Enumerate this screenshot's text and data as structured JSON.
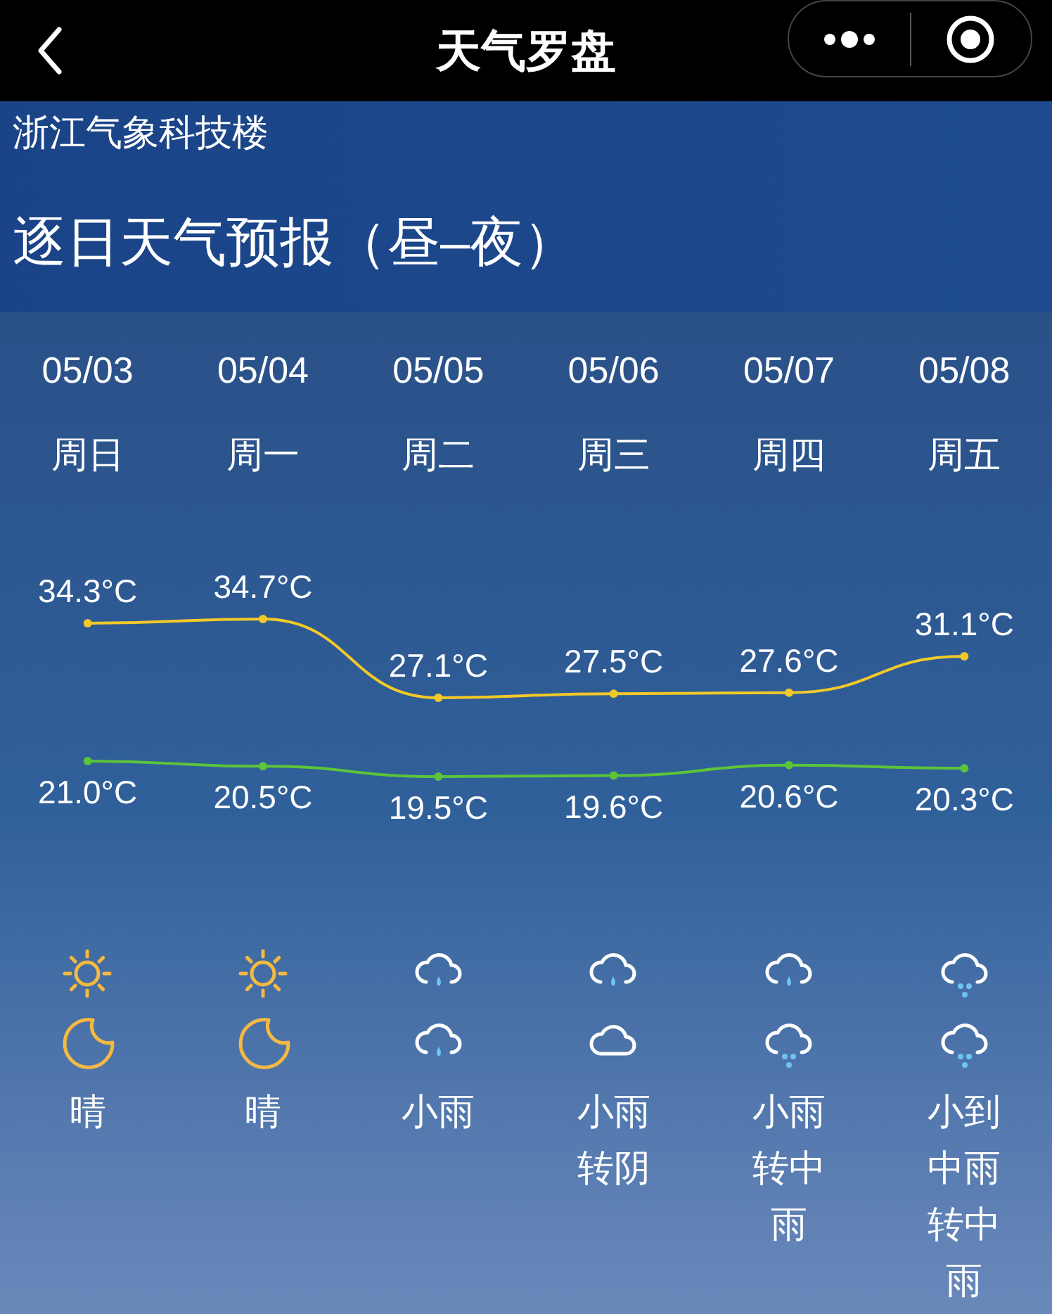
{
  "nav_bar": {
    "title": "天气罗盘"
  },
  "location": "浙江气象科技楼",
  "heading": "逐日天气预报（昼–夜）",
  "days": [
    {
      "date": "05/03",
      "weekday": "周日",
      "icons": [
        {
          "kind": "sun"
        },
        {
          "kind": "moon"
        }
      ],
      "weather": "晴"
    },
    {
      "date": "05/04",
      "weekday": "周一",
      "icons": [
        {
          "kind": "sun"
        },
        {
          "kind": "moon"
        }
      ],
      "weather": "晴"
    },
    {
      "date": "05/05",
      "weekday": "周二",
      "icons": [
        {
          "kind": "rain"
        },
        {
          "kind": "rain"
        }
      ],
      "weather": "小雨"
    },
    {
      "date": "05/06",
      "weekday": "周三",
      "icons": [
        {
          "kind": "rain"
        },
        {
          "kind": "cloud"
        }
      ],
      "weather": "小雨转阴"
    },
    {
      "date": "05/07",
      "weekday": "周四",
      "icons": [
        {
          "kind": "rain"
        },
        {
          "kind": "drizzle"
        }
      ],
      "weather": "小雨转中雨"
    },
    {
      "date": "05/08",
      "weekday": "周五",
      "icons": [
        {
          "kind": "drizzle"
        },
        {
          "kind": "drizzle"
        }
      ],
      "weather": "小到中雨转中雨"
    }
  ],
  "chart_data": {
    "type": "line",
    "data_labels": true,
    "series": [
      {
        "color": "#f2c928",
        "marker": true,
        "values": [
          34.3,
          34.7,
          27.1,
          27.5,
          27.6,
          31.1
        ],
        "value_labels": [
          "34.3°C",
          "34.7°C",
          "27.1°C",
          "27.5°C",
          "27.6°C",
          "31.1°C"
        ]
      },
      {
        "color": "#5cc43a",
        "marker": true,
        "values": [
          21.0,
          20.5,
          19.5,
          19.6,
          20.6,
          20.3
        ],
        "value_labels": [
          "21.0°C",
          "20.5°C",
          "19.5°C",
          "19.6°C",
          "20.6°C",
          "20.3°C"
        ]
      }
    ]
  }
}
